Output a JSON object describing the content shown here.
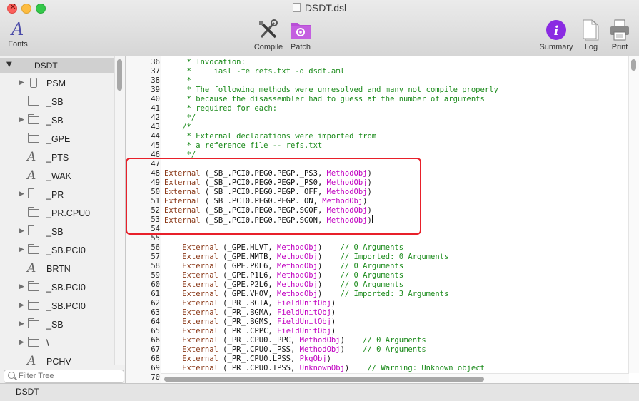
{
  "window": {
    "title": "DSDT.dsl"
  },
  "toolbar": {
    "fonts": "Fonts",
    "compile": "Compile",
    "patch": "Patch",
    "summary": "Summary",
    "log": "Log",
    "print": "Print"
  },
  "sidebar": {
    "root": "DSDT",
    "items": [
      {
        "label": "PSM",
        "icon": "cylinder-icon",
        "expandable": true
      },
      {
        "label": "_SB",
        "icon": "folder-icon",
        "expandable": false
      },
      {
        "label": "_SB",
        "icon": "folder-icon",
        "expandable": true
      },
      {
        "label": "_GPE",
        "icon": "folder-icon",
        "expandable": false
      },
      {
        "label": "_PTS",
        "icon": "method-icon",
        "expandable": false
      },
      {
        "label": "_WAK",
        "icon": "method-icon",
        "expandable": false
      },
      {
        "label": "_PR",
        "icon": "folder-icon",
        "expandable": true
      },
      {
        "label": "_PR.CPU0",
        "icon": "folder-icon",
        "expandable": false
      },
      {
        "label": "_SB",
        "icon": "folder-icon",
        "expandable": true
      },
      {
        "label": "_SB.PCI0",
        "icon": "folder-icon",
        "expandable": true
      },
      {
        "label": "BRTN",
        "icon": "method-icon",
        "expandable": false
      },
      {
        "label": "_SB.PCI0",
        "icon": "folder-icon",
        "expandable": true
      },
      {
        "label": "_SB.PCI0",
        "icon": "folder-icon",
        "expandable": true
      },
      {
        "label": "_SB",
        "icon": "folder-icon",
        "expandable": true
      },
      {
        "label": "\\",
        "icon": "folder-icon",
        "expandable": true
      },
      {
        "label": "PCHV",
        "icon": "method-icon",
        "expandable": false
      }
    ],
    "filter_placeholder": "Filter Tree"
  },
  "editor": {
    "lines": [
      {
        "n": "36",
        "parts": [
          {
            "t": "     * Invocation:",
            "c": "cm"
          }
        ]
      },
      {
        "n": "37",
        "parts": [
          {
            "t": "     *     iasl -fe refs.txt -d dsdt.aml",
            "c": "cm"
          }
        ]
      },
      {
        "n": "38",
        "parts": [
          {
            "t": "     *",
            "c": "cm"
          }
        ]
      },
      {
        "n": "39",
        "parts": [
          {
            "t": "     * The following methods were unresolved and many not compile properly",
            "c": "cm"
          }
        ]
      },
      {
        "n": "40",
        "parts": [
          {
            "t": "     * because the disassembler had to guess at the number of arguments",
            "c": "cm"
          }
        ]
      },
      {
        "n": "41",
        "parts": [
          {
            "t": "     * required for each:",
            "c": "cm"
          }
        ]
      },
      {
        "n": "42",
        "parts": [
          {
            "t": "     */",
            "c": "cm"
          }
        ]
      },
      {
        "n": "43",
        "parts": [
          {
            "t": "    /*",
            "c": "cm"
          }
        ]
      },
      {
        "n": "44",
        "parts": [
          {
            "t": "     * External declarations were imported from",
            "c": "cm"
          }
        ]
      },
      {
        "n": "45",
        "parts": [
          {
            "t": "     * a reference file -- refs.txt",
            "c": "cm"
          }
        ]
      },
      {
        "n": "46",
        "parts": [
          {
            "t": "     */",
            "c": "cm"
          }
        ]
      },
      {
        "n": "47",
        "parts": []
      },
      {
        "n": "48",
        "parts": [
          {
            "t": "External",
            "c": "kw"
          },
          {
            "t": " (_SB_.PCI0.PEG0.PEGP._PS3, ",
            "c": "tx"
          },
          {
            "t": "MethodObj",
            "c": "ty"
          },
          {
            "t": ")",
            "c": "tx"
          }
        ]
      },
      {
        "n": "49",
        "parts": [
          {
            "t": "External",
            "c": "kw"
          },
          {
            "t": " (_SB_.PCI0.PEG0.PEGP._PS0, ",
            "c": "tx"
          },
          {
            "t": "MethodObj",
            "c": "ty"
          },
          {
            "t": ")",
            "c": "tx"
          }
        ]
      },
      {
        "n": "50",
        "parts": [
          {
            "t": "External",
            "c": "kw"
          },
          {
            "t": " (_SB_.PCI0.PEG0.PEGP._OFF, ",
            "c": "tx"
          },
          {
            "t": "MethodObj",
            "c": "ty"
          },
          {
            "t": ")",
            "c": "tx"
          }
        ]
      },
      {
        "n": "51",
        "parts": [
          {
            "t": "External",
            "c": "kw"
          },
          {
            "t": " (_SB_.PCI0.PEG0.PEGP._ON, ",
            "c": "tx"
          },
          {
            "t": "MethodObj",
            "c": "ty"
          },
          {
            "t": ")",
            "c": "tx"
          }
        ]
      },
      {
        "n": "52",
        "parts": [
          {
            "t": "External",
            "c": "kw"
          },
          {
            "t": " (_SB_.PCI0.PEG0.PEGP.SGOF, ",
            "c": "tx"
          },
          {
            "t": "MethodObj",
            "c": "ty"
          },
          {
            "t": ")",
            "c": "tx"
          }
        ]
      },
      {
        "n": "53",
        "parts": [
          {
            "t": "External",
            "c": "kw"
          },
          {
            "t": " (_SB_.PCI0.PEG0.PEGP.SGON, ",
            "c": "tx"
          },
          {
            "t": "MethodObj",
            "c": "ty"
          },
          {
            "t": ")",
            "c": "tx"
          }
        ]
      },
      {
        "n": "54",
        "parts": []
      },
      {
        "n": "55",
        "parts": []
      },
      {
        "n": "56",
        "parts": [
          {
            "t": "    External",
            "c": "kw"
          },
          {
            "t": " (_GPE.HLVT, ",
            "c": "tx"
          },
          {
            "t": "MethodObj",
            "c": "ty"
          },
          {
            "t": ")    ",
            "c": "tx"
          },
          {
            "t": "// 0 Arguments",
            "c": "cm"
          }
        ]
      },
      {
        "n": "57",
        "parts": [
          {
            "t": "    External",
            "c": "kw"
          },
          {
            "t": " (_GPE.MMTB, ",
            "c": "tx"
          },
          {
            "t": "MethodObj",
            "c": "ty"
          },
          {
            "t": ")    ",
            "c": "tx"
          },
          {
            "t": "// Imported: 0 Arguments",
            "c": "cm"
          }
        ]
      },
      {
        "n": "58",
        "parts": [
          {
            "t": "    External",
            "c": "kw"
          },
          {
            "t": " (_GPE.P0L6, ",
            "c": "tx"
          },
          {
            "t": "MethodObj",
            "c": "ty"
          },
          {
            "t": ")    ",
            "c": "tx"
          },
          {
            "t": "// 0 Arguments",
            "c": "cm"
          }
        ]
      },
      {
        "n": "59",
        "parts": [
          {
            "t": "    External",
            "c": "kw"
          },
          {
            "t": " (_GPE.P1L6, ",
            "c": "tx"
          },
          {
            "t": "MethodObj",
            "c": "ty"
          },
          {
            "t": ")    ",
            "c": "tx"
          },
          {
            "t": "// 0 Arguments",
            "c": "cm"
          }
        ]
      },
      {
        "n": "60",
        "parts": [
          {
            "t": "    External",
            "c": "kw"
          },
          {
            "t": " (_GPE.P2L6, ",
            "c": "tx"
          },
          {
            "t": "MethodObj",
            "c": "ty"
          },
          {
            "t": ")    ",
            "c": "tx"
          },
          {
            "t": "// 0 Arguments",
            "c": "cm"
          }
        ]
      },
      {
        "n": "61",
        "parts": [
          {
            "t": "    External",
            "c": "kw"
          },
          {
            "t": " (_GPE.VHOV, ",
            "c": "tx"
          },
          {
            "t": "MethodObj",
            "c": "ty"
          },
          {
            "t": ")    ",
            "c": "tx"
          },
          {
            "t": "// Imported: 3 Arguments",
            "c": "cm"
          }
        ]
      },
      {
        "n": "62",
        "parts": [
          {
            "t": "    External",
            "c": "kw"
          },
          {
            "t": " (_PR_.BGIA, ",
            "c": "tx"
          },
          {
            "t": "FieldUnitObj",
            "c": "ty"
          },
          {
            "t": ")",
            "c": "tx"
          }
        ]
      },
      {
        "n": "63",
        "parts": [
          {
            "t": "    External",
            "c": "kw"
          },
          {
            "t": " (_PR_.BGMA, ",
            "c": "tx"
          },
          {
            "t": "FieldUnitObj",
            "c": "ty"
          },
          {
            "t": ")",
            "c": "tx"
          }
        ]
      },
      {
        "n": "64",
        "parts": [
          {
            "t": "    External",
            "c": "kw"
          },
          {
            "t": " (_PR_.BGMS, ",
            "c": "tx"
          },
          {
            "t": "FieldUnitObj",
            "c": "ty"
          },
          {
            "t": ")",
            "c": "tx"
          }
        ]
      },
      {
        "n": "65",
        "parts": [
          {
            "t": "    External",
            "c": "kw"
          },
          {
            "t": " (_PR_.CPPC, ",
            "c": "tx"
          },
          {
            "t": "FieldUnitObj",
            "c": "ty"
          },
          {
            "t": ")",
            "c": "tx"
          }
        ]
      },
      {
        "n": "66",
        "parts": [
          {
            "t": "    External",
            "c": "kw"
          },
          {
            "t": " (_PR_.CPU0._PPC, ",
            "c": "tx"
          },
          {
            "t": "MethodObj",
            "c": "ty"
          },
          {
            "t": ")    ",
            "c": "tx"
          },
          {
            "t": "// 0 Arguments",
            "c": "cm"
          }
        ]
      },
      {
        "n": "67",
        "parts": [
          {
            "t": "    External",
            "c": "kw"
          },
          {
            "t": " (_PR_.CPU0._PSS, ",
            "c": "tx"
          },
          {
            "t": "MethodObj",
            "c": "ty"
          },
          {
            "t": ")    ",
            "c": "tx"
          },
          {
            "t": "// 0 Arguments",
            "c": "cm"
          }
        ]
      },
      {
        "n": "68",
        "parts": [
          {
            "t": "    External",
            "c": "kw"
          },
          {
            "t": " (_PR_.CPU0.LPSS, ",
            "c": "tx"
          },
          {
            "t": "PkgObj",
            "c": "ty"
          },
          {
            "t": ")",
            "c": "tx"
          }
        ]
      },
      {
        "n": "69",
        "parts": [
          {
            "t": "    External",
            "c": "kw"
          },
          {
            "t": " (_PR_.CPU0.TPSS, ",
            "c": "tx"
          },
          {
            "t": "UnknownObj",
            "c": "ty"
          },
          {
            "t": ")    ",
            "c": "tx"
          },
          {
            "t": "// Warning: Unknown object",
            "c": "cm"
          }
        ]
      },
      {
        "n": "70",
        "parts": []
      }
    ],
    "cursor_line": "53"
  },
  "statusbar": {
    "text": "DSDT"
  },
  "colors": {
    "comment": "#1a8a1a",
    "keyword": "#8b3a1a",
    "type": "#c000c0",
    "highlight_box": "#e8202a"
  }
}
